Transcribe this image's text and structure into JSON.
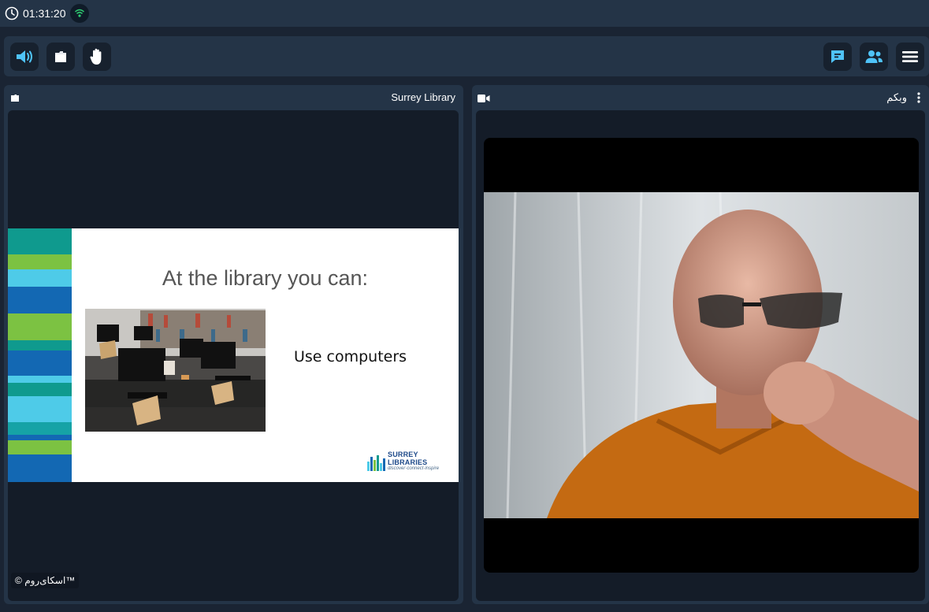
{
  "status": {
    "elapsed_time": "01:31:20"
  },
  "toolbar": {
    "left_buttons": [
      "speaker",
      "presentation",
      "raise-hand"
    ],
    "right_buttons": [
      "chat",
      "participants",
      "menu"
    ],
    "accent_color": "#4fc3f7"
  },
  "presentation_panel": {
    "title": "Surrey Library",
    "slide": {
      "heading": "At the library you can:",
      "body_text": "Use computers",
      "logo_name": "SURREY LIBRARIES",
      "logo_tagline": "discover·connect·inspire"
    },
    "brand_watermark": "© اسکای‌روم™"
  },
  "webcam_panel": {
    "title": "وبکم"
  },
  "colors": {
    "background": "#1a2433",
    "panel": "#243447",
    "panel_body": "#141c28",
    "accent": "#4fc3f7",
    "network_ok": "#2ecc71"
  }
}
